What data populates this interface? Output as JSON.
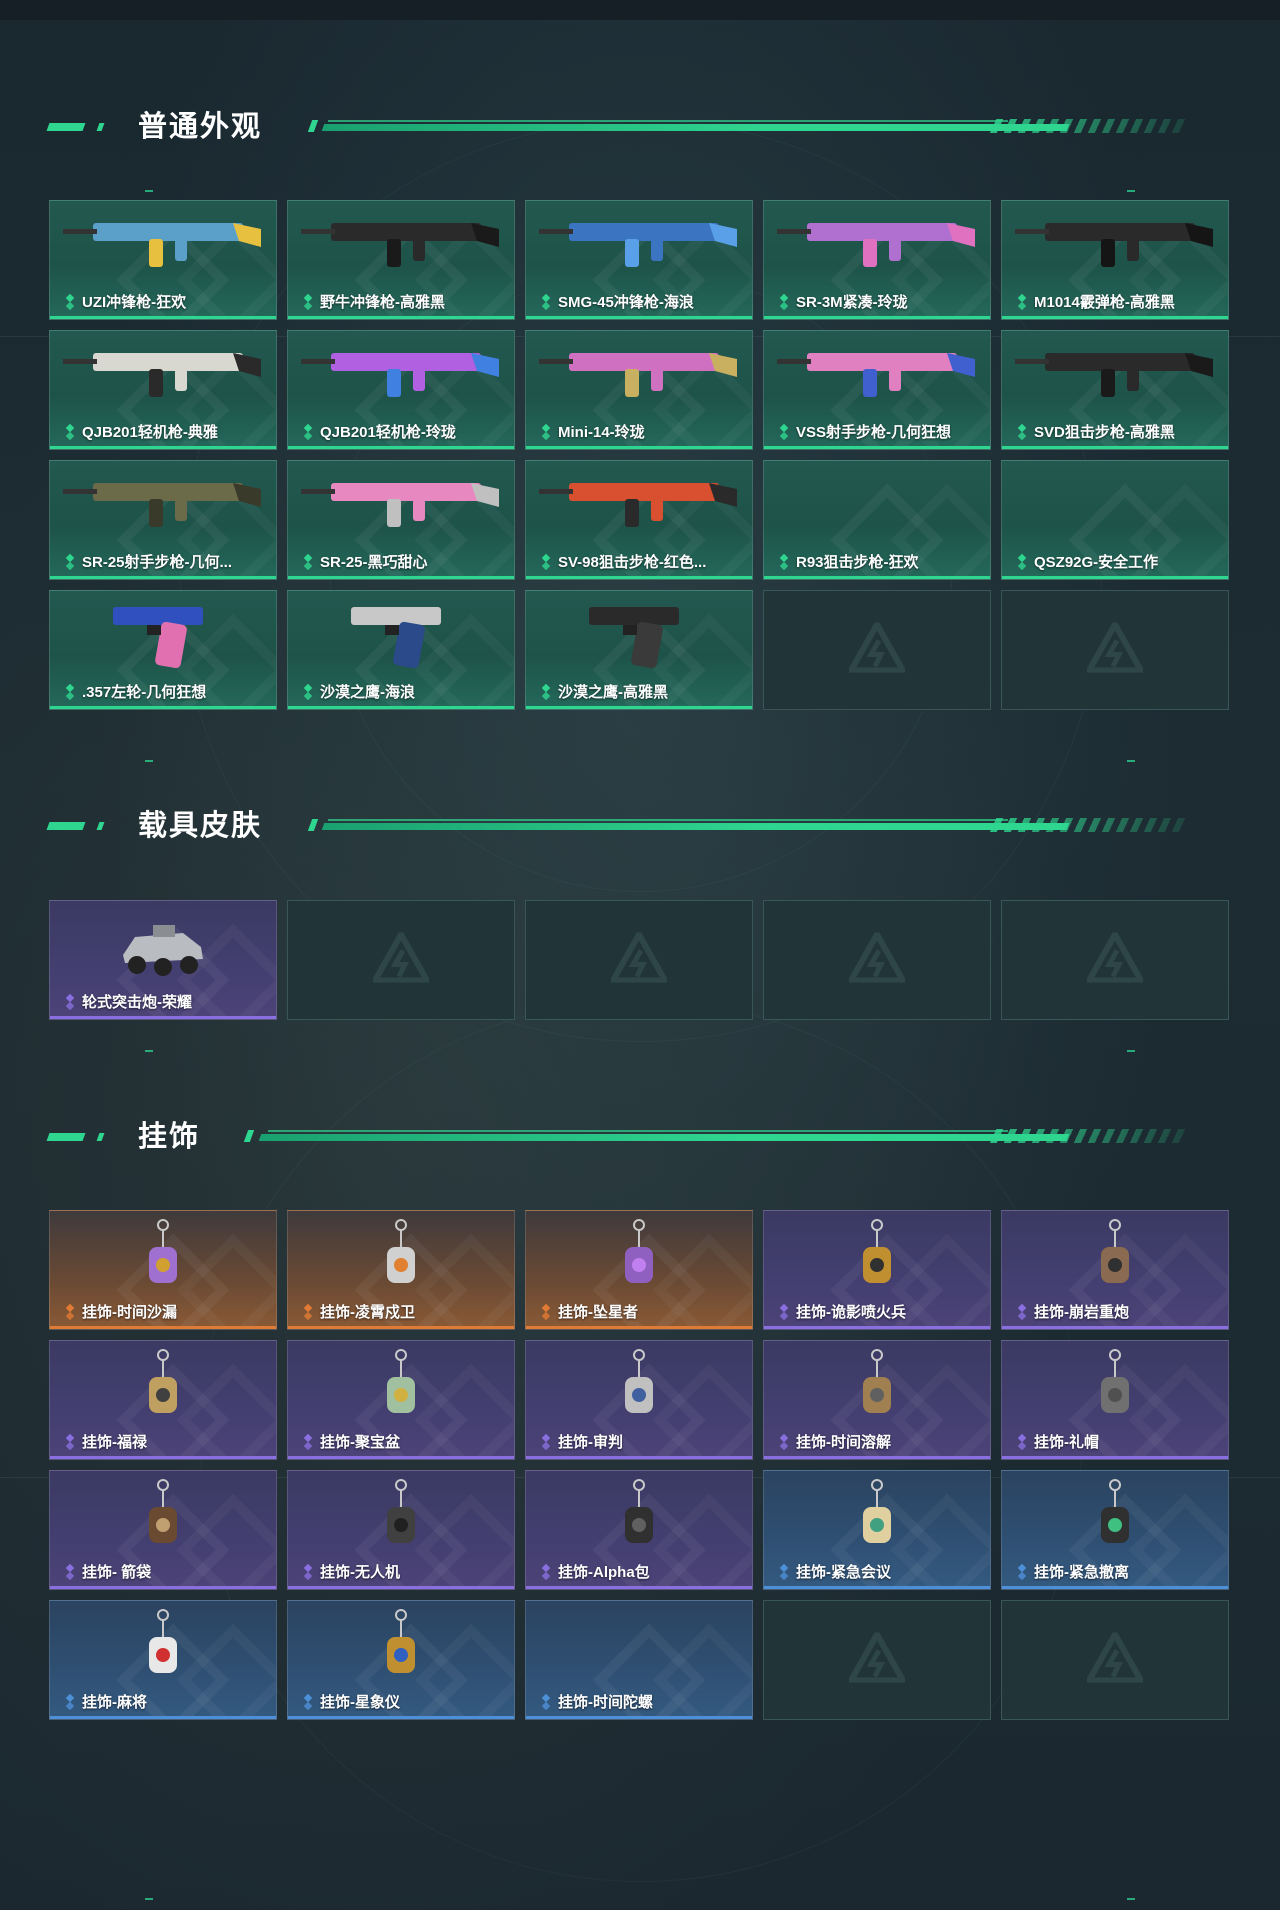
{
  "sections": [
    {
      "title": "普通外观",
      "items": [
        {
          "label": "UZI冲锋枪-狂欢",
          "rarity": "green",
          "icon": "smg-icon"
        },
        {
          "label": "野牛冲锋枪-高雅黑",
          "rarity": "green",
          "icon": "smg-icon"
        },
        {
          "label": "SMG-45冲锋枪-海浪",
          "rarity": "green",
          "icon": "smg-icon"
        },
        {
          "label": "SR-3M紧凑-玲珑",
          "rarity": "green",
          "icon": "rifle-icon"
        },
        {
          "label": "M1014霰弹枪-高雅黑",
          "rarity": "green",
          "icon": "shotgun-icon"
        },
        {
          "label": "QJB201轻机枪-典雅",
          "rarity": "green",
          "icon": "lmg-icon"
        },
        {
          "label": "QJB201轻机枪-玲珑",
          "rarity": "green",
          "icon": "lmg-icon"
        },
        {
          "label": "Mini-14-玲珑",
          "rarity": "green",
          "icon": "rifle-icon"
        },
        {
          "label": "VSS射手步枪-几何狂想",
          "rarity": "green",
          "icon": "rifle-icon"
        },
        {
          "label": "SVD狙击步枪-高雅黑",
          "rarity": "green",
          "icon": "sniper-icon"
        },
        {
          "label": "SR-25射手步枪-几何...",
          "rarity": "green",
          "icon": "rifle-icon"
        },
        {
          "label": "SR-25-黑巧甜心",
          "rarity": "green",
          "icon": "rifle-icon"
        },
        {
          "label": "SV-98狙击步枪-红色...",
          "rarity": "green",
          "icon": "sniper-icon"
        },
        {
          "label": "R93狙击步枪-狂欢",
          "rarity": "green",
          "icon": ""
        },
        {
          "label": "QSZ92G-安全工作",
          "rarity": "green",
          "icon": ""
        },
        {
          "label": ".357左轮-几何狂想",
          "rarity": "green",
          "icon": "revolver-icon"
        },
        {
          "label": "沙漠之鹰-海浪",
          "rarity": "green",
          "icon": "pistol-icon"
        },
        {
          "label": "沙漠之鹰-高雅黑",
          "rarity": "green",
          "icon": "pistol-icon"
        },
        {
          "label": "",
          "rarity": "empty",
          "icon": "placeholder-logo-icon"
        },
        {
          "label": "",
          "rarity": "empty",
          "icon": "placeholder-logo-icon"
        }
      ]
    },
    {
      "title": "载具皮肤",
      "items": [
        {
          "label": "轮式突击炮-荣耀",
          "rarity": "purple",
          "icon": "vehicle-icon"
        },
        {
          "label": "",
          "rarity": "empty",
          "icon": "placeholder-logo-icon"
        },
        {
          "label": "",
          "rarity": "empty",
          "icon": "placeholder-logo-icon"
        },
        {
          "label": "",
          "rarity": "empty",
          "icon": "placeholder-logo-icon"
        },
        {
          "label": "",
          "rarity": "empty",
          "icon": "placeholder-logo-icon"
        }
      ]
    },
    {
      "title": "挂饰",
      "items": [
        {
          "label": "挂饰-时间沙漏",
          "rarity": "orange",
          "icon": "charm-icon"
        },
        {
          "label": "挂饰-凌霄戍卫",
          "rarity": "orange",
          "icon": "charm-icon"
        },
        {
          "label": "挂饰-坠星者",
          "rarity": "orange",
          "icon": "charm-icon"
        },
        {
          "label": "挂饰-诡影喷火兵",
          "rarity": "purple",
          "icon": "charm-icon"
        },
        {
          "label": "挂饰-崩岩重炮",
          "rarity": "purple",
          "icon": "charm-icon"
        },
        {
          "label": "挂饰-福禄",
          "rarity": "purple",
          "icon": "charm-icon"
        },
        {
          "label": "挂饰-聚宝盆",
          "rarity": "purple",
          "icon": "charm-icon"
        },
        {
          "label": "挂饰-审判",
          "rarity": "purple",
          "icon": "charm-icon"
        },
        {
          "label": "挂饰-时间溶解",
          "rarity": "purple",
          "icon": "charm-icon"
        },
        {
          "label": "挂饰-礼帽",
          "rarity": "purple",
          "icon": "charm-icon"
        },
        {
          "label": "挂饰- 箭袋",
          "rarity": "purple",
          "icon": "charm-icon"
        },
        {
          "label": "挂饰-无人机",
          "rarity": "purple",
          "icon": "charm-icon"
        },
        {
          "label": "挂饰-Alpha包",
          "rarity": "purple",
          "icon": "charm-icon"
        },
        {
          "label": "挂饰-紧急会议",
          "rarity": "blue",
          "icon": "charm-icon"
        },
        {
          "label": "挂饰-紧急撤离",
          "rarity": "blue",
          "icon": "charm-icon"
        },
        {
          "label": "挂饰-麻将",
          "rarity": "blue",
          "icon": "charm-icon"
        },
        {
          "label": "挂饰-星象仪",
          "rarity": "blue",
          "icon": "charm-icon"
        },
        {
          "label": "挂饰-时间陀螺",
          "rarity": "blue",
          "icon": ""
        },
        {
          "label": "",
          "rarity": "empty",
          "icon": "placeholder-logo-icon"
        },
        {
          "label": "",
          "rarity": "empty",
          "icon": "placeholder-logo-icon"
        }
      ]
    }
  ],
  "colors": {
    "accent": "#2fd690",
    "green": "#2fd690",
    "purple": "#8a6fe0",
    "orange": "#e07b35",
    "blue": "#4d90d8"
  }
}
